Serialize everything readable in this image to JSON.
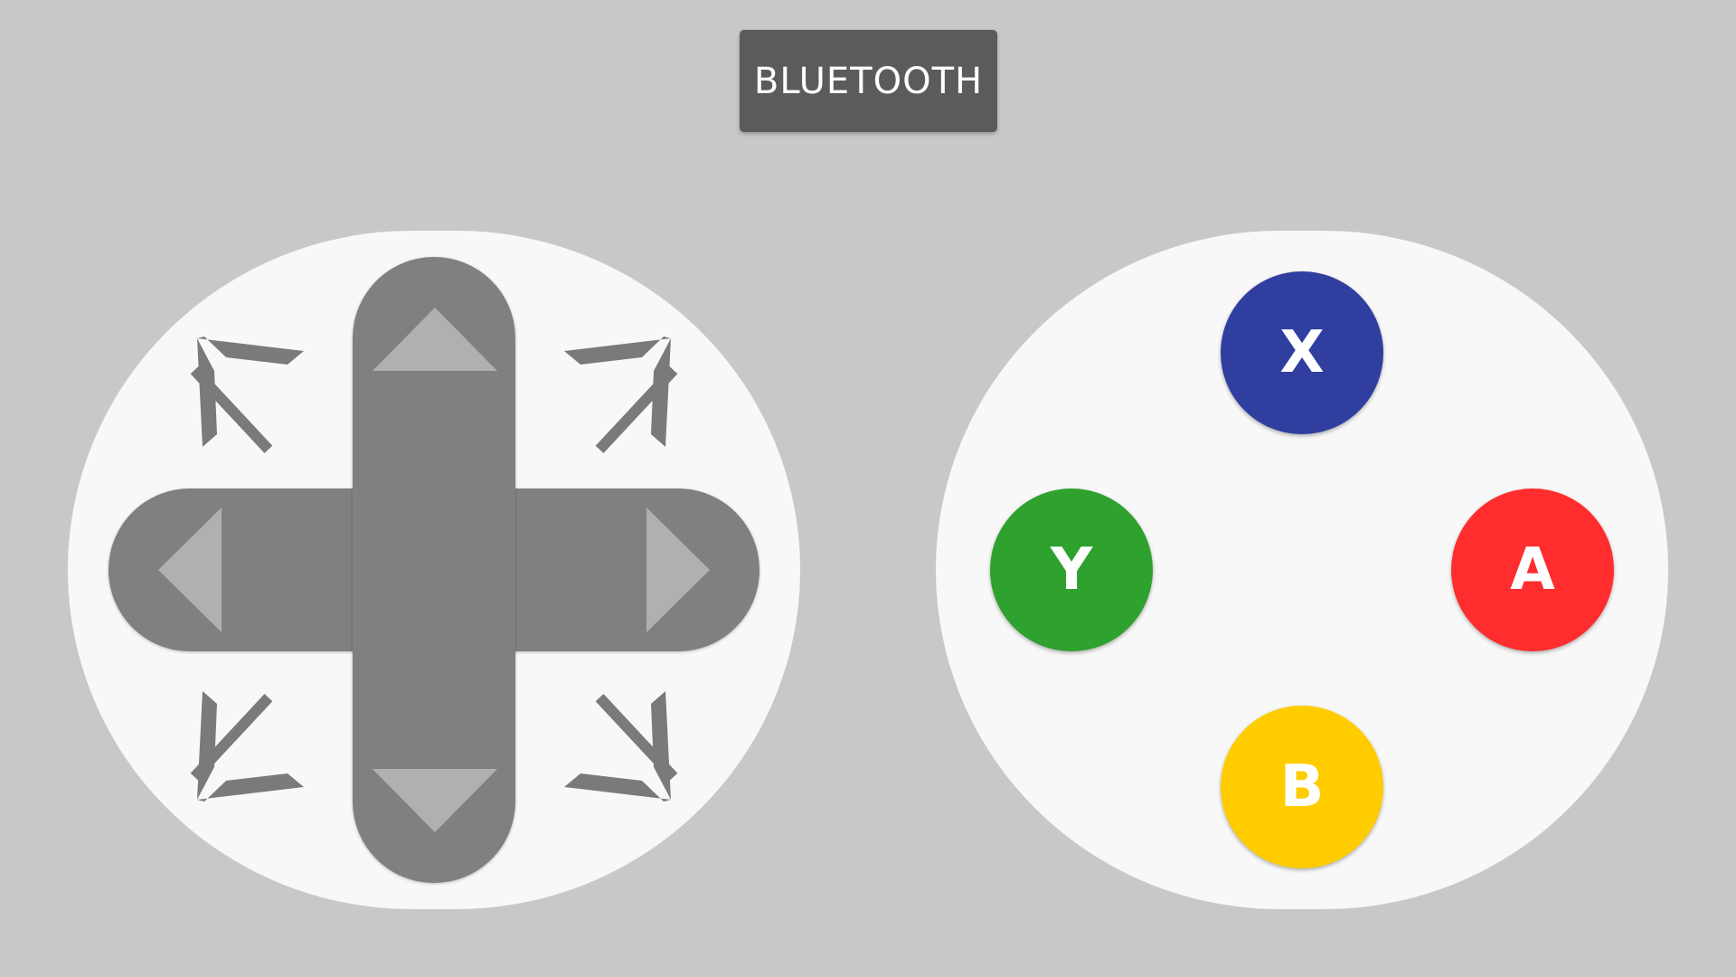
{
  "header": {
    "bluetooth_label": "BLUETOOTH"
  },
  "dpad": {
    "body_color": "#808080",
    "arrow_color": "#b0b0b0",
    "diagonal_color": "#7a7a7a",
    "up_icon": "triangle-up",
    "down_icon": "triangle-down",
    "left_icon": "triangle-left",
    "right_icon": "triangle-right",
    "diagonals": [
      "arrow-up-left",
      "arrow-up-right",
      "arrow-down-left",
      "arrow-down-right"
    ]
  },
  "face_buttons": {
    "x": {
      "label": "X",
      "color": "#303f9f"
    },
    "y": {
      "label": "Y",
      "color": "#2ea12e"
    },
    "a": {
      "label": "A",
      "color": "#ff2d2d"
    },
    "b": {
      "label": "B",
      "color": "#ffcc00"
    }
  },
  "colors": {
    "background": "#c8c8c8",
    "pad": "#f8f8f8",
    "bluetooth_button": "#5b5b5b"
  }
}
